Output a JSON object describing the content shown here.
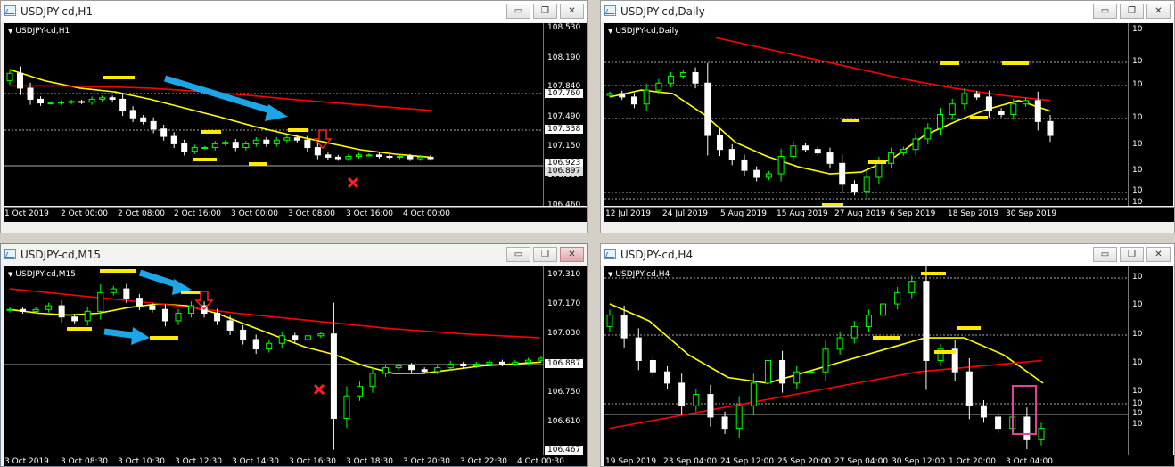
{
  "windows": [
    {
      "id": "h1",
      "title": "USDJPY-cd,H1",
      "chart_label": "USDJPY-cd,H1",
      "y_labels": [
        "108.530",
        "108.190",
        "107.840",
        "107.490",
        "107.150",
        "106.800",
        "106.460"
      ],
      "y_tags": [
        "107.760",
        "107.338",
        "106.923",
        "106.897"
      ],
      "x_labels": [
        "1 Oct 2019",
        "2 Oct 00:00",
        "2 Oct 08:00",
        "2 Oct 16:00",
        "3 Oct 00:00",
        "3 Oct 08:00",
        "3 Oct 16:00",
        "4 Oct 00:00"
      ]
    },
    {
      "id": "daily",
      "title": "USDJPY-cd,Daily",
      "chart_label": "USDJPY-cd,Daily",
      "y_labels": [
        "10",
        "10",
        "10",
        "10",
        "10",
        "10",
        "10",
        "10"
      ],
      "y_tags": [],
      "x_labels": [
        "12 Jul 2019",
        "24 Jul 2019",
        "5 Aug 2019",
        "15 Aug 2019",
        "27 Aug 2019",
        "6 Sep 2019",
        "18 Sep 2019",
        "30 Sep 2019"
      ]
    },
    {
      "id": "m15",
      "title": "USDJPY-cd,M15",
      "chart_label": "USDJPY-cd,M15",
      "y_labels": [
        "107.310",
        "107.170",
        "107.030",
        "106.750",
        "106.610"
      ],
      "y_tags": [
        "106.887",
        "106.467"
      ],
      "x_labels": [
        "3 Oct 2019",
        "3 Oct 08:30",
        "3 Oct 10:30",
        "3 Oct 12:30",
        "3 Oct 14:30",
        "3 Oct 16:30",
        "3 Oct 18:30",
        "3 Oct 20:30",
        "3 Oct 22:30",
        "4 Oct 00:30"
      ]
    },
    {
      "id": "h4",
      "title": "USDJPY-cd,H4",
      "chart_label": "USDJPY-cd,H4",
      "y_labels": [
        "10",
        "10",
        "10",
        "10",
        "10",
        "10",
        "10",
        "10"
      ],
      "y_tags": [],
      "x_labels": [
        "19 Sep 2019",
        "23 Sep 04:00",
        "24 Sep 12:00",
        "25 Sep 20:00",
        "27 Sep 04:00",
        "30 Sep 12:00",
        "1 Oct 20:00",
        "3 Oct 04:00"
      ]
    }
  ],
  "buttons": {
    "minimize": "▭",
    "restore": "❐",
    "close": "✕"
  },
  "colors": {
    "bull": "#00ff00",
    "bear": "#ffffff",
    "ma_fast": "#ffff00",
    "ma_slow": "#ff0000",
    "annot_blue": "#1ea5e8",
    "annot_yellow": "#ffea00",
    "mark": "#ff2020",
    "box": "#e0449a"
  },
  "chart_data": [
    {
      "type": "candlestick",
      "title": "USDJPY-cd,H1",
      "ylim": [
        106.46,
        108.53
      ],
      "x_ticks": [
        "1 Oct 2019",
        "2 Oct 00:00",
        "2 Oct 08:00",
        "2 Oct 16:00",
        "3 Oct 00:00",
        "3 Oct 08:00",
        "3 Oct 16:00",
        "4 Oct 00:00"
      ],
      "close_path": [
        108.05,
        107.85,
        107.7,
        107.65,
        107.65,
        107.66,
        107.67,
        107.66,
        107.7,
        107.72,
        107.7,
        107.55,
        107.45,
        107.4,
        107.3,
        107.2,
        107.1,
        107.0,
        107.05,
        107.05,
        107.1,
        107.12,
        107.05,
        107.1,
        107.15,
        107.1,
        107.15,
        107.18,
        107.15,
        107.05,
        106.95,
        106.92,
        106.9,
        106.93,
        106.95,
        106.95,
        106.93,
        106.92,
        106.93,
        106.9,
        106.92,
        106.9
      ],
      "moving_averages": [
        {
          "color": "yellow",
          "values": [
            108.1,
            107.95,
            107.85,
            107.8,
            107.7,
            107.58,
            107.46,
            107.33,
            107.22,
            107.12,
            107.02,
            106.96,
            106.92
          ]
        },
        {
          "color": "red",
          "values": [
            107.88,
            107.88,
            107.87,
            107.85,
            107.81,
            107.76,
            107.7,
            107.65,
            107.6,
            107.55
          ]
        }
      ]
    },
    {
      "type": "candlestick",
      "title": "USDJPY-cd,Daily",
      "x_ticks": [
        "12 Jul 2019",
        "24 Jul 2019",
        "5 Aug 2019",
        "15 Aug 2019",
        "27 Aug 2019",
        "6 Sep 2019",
        "18 Sep 2019",
        "30 Sep 2019"
      ],
      "close_path": [
        108.2,
        108.1,
        107.9,
        108.3,
        108.5,
        108.7,
        108.8,
        108.5,
        107.0,
        106.6,
        106.3,
        106.0,
        105.8,
        105.9,
        106.4,
        106.7,
        106.6,
        106.5,
        106.2,
        105.6,
        105.4,
        105.8,
        106.2,
        106.5,
        106.6,
        106.9,
        107.2,
        107.6,
        107.9,
        108.2,
        108.1,
        107.7,
        107.6,
        107.9,
        108.0,
        107.4,
        107.0
      ],
      "moving_averages": [
        {
          "color": "yellow",
          "values": [
            108.1,
            108.3,
            108.2,
            107.6,
            106.8,
            106.4,
            106.1,
            105.9,
            105.95,
            106.35,
            107.0,
            107.4,
            107.75,
            108.0,
            107.7
          ]
        },
        {
          "color": "red",
          "values": [
            109.8,
            109.5,
            109.2,
            108.9,
            108.6,
            108.35,
            108.15,
            108.0
          ]
        }
      ]
    },
    {
      "type": "candlestick",
      "title": "USDJPY-cd,M15",
      "ylim": [
        106.467,
        107.31
      ],
      "x_ticks": [
        "3 Oct 2019",
        "3 Oct 08:30",
        "3 Oct 10:30",
        "3 Oct 12:30",
        "3 Oct 14:30",
        "3 Oct 16:30",
        "3 Oct 18:30",
        "3 Oct 20:30",
        "3 Oct 22:30",
        "4 Oct 00:30"
      ],
      "close_path": [
        107.16,
        107.15,
        107.16,
        107.18,
        107.12,
        107.1,
        107.15,
        107.25,
        107.27,
        107.22,
        107.18,
        107.16,
        107.1,
        107.14,
        107.18,
        107.14,
        107.1,
        107.05,
        107.0,
        106.95,
        106.98,
        107.02,
        107.0,
        107.02,
        107.03,
        106.58,
        106.7,
        106.75,
        106.82,
        106.85,
        106.86,
        106.84,
        106.83,
        106.85,
        106.87,
        106.86,
        106.87,
        106.88,
        106.87,
        106.88,
        106.89,
        106.9
      ],
      "moving_averages": [
        {
          "color": "yellow",
          "values": [
            107.16,
            107.14,
            107.13,
            107.14,
            107.17,
            107.19,
            107.18,
            107.14,
            107.08,
            107.02,
            106.96,
            106.92,
            106.86,
            106.82,
            106.82,
            106.84,
            106.86,
            106.87,
            106.88
          ]
        },
        {
          "color": "red",
          "values": [
            107.27,
            107.23,
            107.19,
            107.14,
            107.1,
            107.06,
            107.03,
            107.01
          ]
        }
      ]
    },
    {
      "type": "candlestick",
      "title": "USDJPY-cd,H4",
      "x_ticks": [
        "19 Sep 2019",
        "23 Sep 04:00",
        "24 Sep 12:00",
        "25 Sep 20:00",
        "27 Sep 04:00",
        "30 Sep 12:00",
        "1 Oct 20:00",
        "3 Oct 04:00"
      ],
      "close_path": [
        107.9,
        107.7,
        107.5,
        107.4,
        107.3,
        107.1,
        107.2,
        107.0,
        106.9,
        107.1,
        107.3,
        107.5,
        107.3,
        107.4,
        107.4,
        107.6,
        107.7,
        107.8,
        107.9,
        108.0,
        108.1,
        108.2,
        107.5,
        107.6,
        107.4,
        107.1,
        107.0,
        106.9,
        107.0,
        106.8,
        106.9
      ],
      "moving_averages": [
        {
          "color": "yellow",
          "values": [
            108.0,
            107.85,
            107.55,
            107.35,
            107.3,
            107.4,
            107.5,
            107.6,
            107.7,
            107.7,
            107.55,
            107.3
          ]
        },
        {
          "color": "red",
          "values": [
            106.9,
            107.0,
            107.1,
            107.2,
            107.3,
            107.4,
            107.45,
            107.5
          ]
        }
      ]
    }
  ]
}
